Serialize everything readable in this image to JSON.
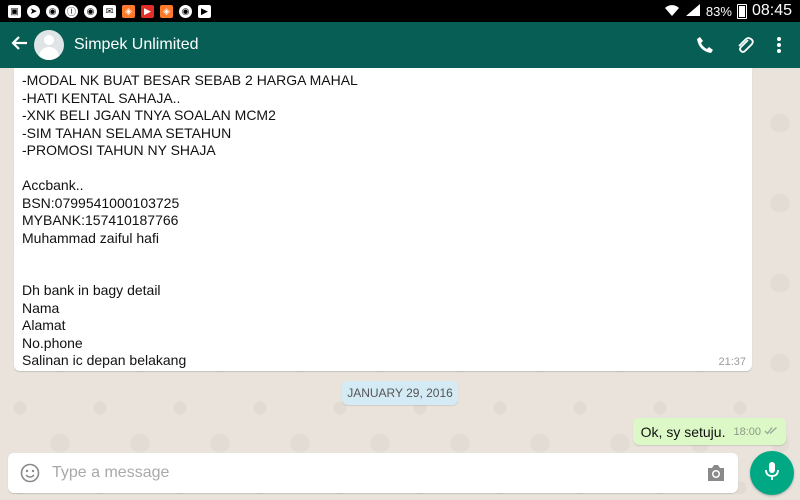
{
  "status_bar": {
    "battery": "83%",
    "time": "08:45",
    "notification_icons": [
      "gallery-icon",
      "telegram-icon",
      "chrome-icon",
      "wave-icon",
      "chrome-icon",
      "mail-icon",
      "game-icon",
      "youtube-icon",
      "game-icon",
      "chrome-icon",
      "media-icon"
    ]
  },
  "header": {
    "contact_name": "Simpek Unlimited"
  },
  "messages": {
    "incoming": {
      "text": "-MODAL NK BUAT BESAR SEBAB 2 HARGA MAHAL\n-HATI KENTAL SAHAJA..\n-XNK BELI JGAN TNYA SOALAN MCM2\n-SIM TAHAN SELAMA SETAHUN\n-PROMOSI TAHUN NY SHAJA\n\nAccbank..\nBSN:0799541000103725\nMYBANK:157410187766\nMuhammad zaiful hafi\n\n\nDh bank in bagy detail\nNama\nAlamat\nNo.phone\nSalinan ic depan belakang",
      "time": "21:37"
    },
    "date_divider": "JANUARY 29, 2016",
    "outgoing": {
      "text": "Ok, sy setuju.",
      "time": "18:00"
    }
  },
  "composer": {
    "placeholder": "Type a message"
  },
  "colors": {
    "app_bar": "#075e54",
    "outgoing_bubble": "#dcf8c6",
    "send_button": "#00a884"
  }
}
